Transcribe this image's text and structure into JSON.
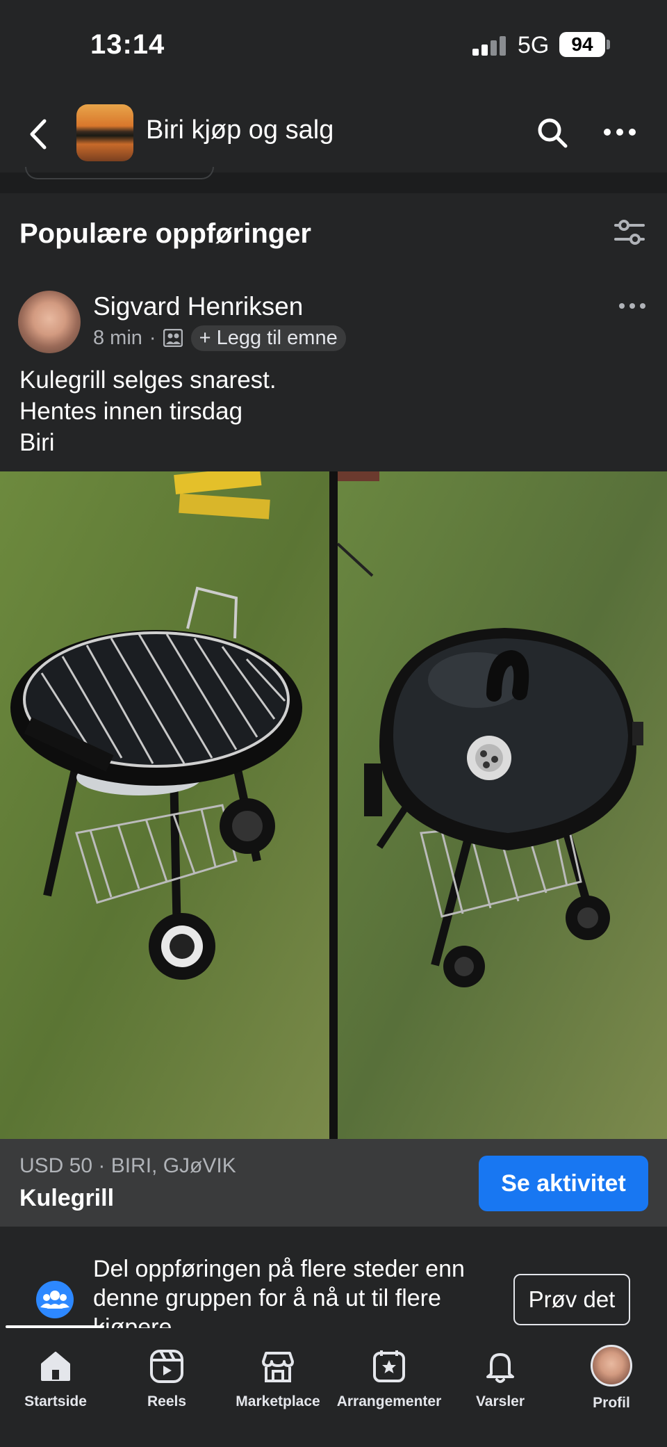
{
  "status_bar": {
    "time": "13:14",
    "network": "5G",
    "battery": "94"
  },
  "header": {
    "group_name": "Biri kjøp og salg"
  },
  "section": {
    "title": "Populære oppføringer"
  },
  "post": {
    "author": "Sigvard Henriksen",
    "time": "8 min",
    "separator": "·",
    "add_topic": "+ Legg til emne",
    "text_lines": [
      "Kulegrill selges snarest.",
      "Hentes innen tirsdag",
      "Biri"
    ]
  },
  "listing": {
    "price_location": "USD 50 · BIRI, GJøVIK",
    "title": "Kulegrill",
    "action_label": "Se aktivitet"
  },
  "promo": {
    "text": "Del oppføringen på flere steder enn denne gruppen for å nå ut til flere kjøpere",
    "button_label": "Prøv det"
  },
  "tabbar": {
    "items": [
      {
        "label": "Startside",
        "icon": "home-icon",
        "active": true
      },
      {
        "label": "Reels",
        "icon": "reels-icon"
      },
      {
        "label": "Marketplace",
        "icon": "marketplace-icon"
      },
      {
        "label": "Arrangementer",
        "icon": "events-icon"
      },
      {
        "label": "Varsler",
        "icon": "bell-icon"
      },
      {
        "label": "Profil",
        "icon": "profile-avatar"
      }
    ]
  },
  "colors": {
    "background": "#242526",
    "accent": "#1877f2",
    "listing_bar": "#3a3b3c"
  }
}
